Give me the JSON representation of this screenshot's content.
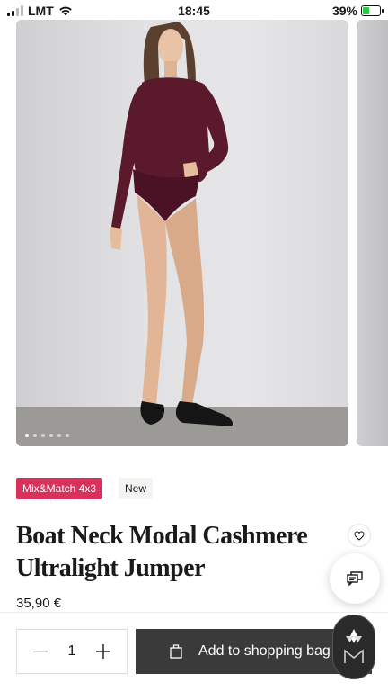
{
  "status_bar": {
    "carrier": "LMT",
    "time": "18:45",
    "battery": "39%",
    "battery_level": 0.39
  },
  "gallery": {
    "photo_count": 6,
    "active_index": 0
  },
  "tags": {
    "promo": "Mix&Match 4x3",
    "new": "New"
  },
  "product": {
    "title": "Boat Neck Modal Cashmere Ultralight Jumper",
    "price": "35,90 €"
  },
  "purchase": {
    "quantity": "1",
    "add_label": "Add to shopping bag"
  },
  "colors": {
    "promo_tag": "#d8315b",
    "add_button": "#3a3a3a",
    "garment": "#5a1a2c"
  }
}
